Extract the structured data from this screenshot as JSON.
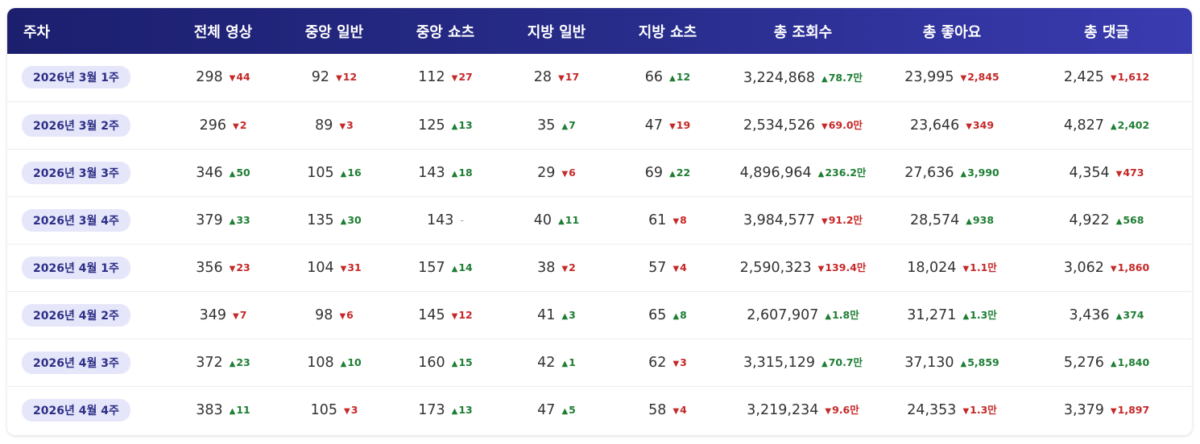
{
  "headers": [
    "주차",
    "전체 영상",
    "중앙 일반",
    "중앙 쇼츠",
    "지방 일반",
    "지방 쇼츠",
    "총 조회수",
    "총 좋아요",
    "총 댓글"
  ],
  "rows": [
    {
      "week": "2026년 3월 1주",
      "cells": [
        {
          "v": "298",
          "d": "44",
          "dir": "down"
        },
        {
          "v": "92",
          "d": "12",
          "dir": "down"
        },
        {
          "v": "112",
          "d": "27",
          "dir": "down"
        },
        {
          "v": "28",
          "d": "17",
          "dir": "down"
        },
        {
          "v": "66",
          "d": "12",
          "dir": "up"
        },
        {
          "v": "3,224,868",
          "d": "78.7만",
          "dir": "up"
        },
        {
          "v": "23,995",
          "d": "2,845",
          "dir": "down"
        },
        {
          "v": "2,425",
          "d": "1,612",
          "dir": "down"
        }
      ]
    },
    {
      "week": "2026년 3월 2주",
      "cells": [
        {
          "v": "296",
          "d": "2",
          "dir": "down"
        },
        {
          "v": "89",
          "d": "3",
          "dir": "down"
        },
        {
          "v": "125",
          "d": "13",
          "dir": "up"
        },
        {
          "v": "35",
          "d": "7",
          "dir": "up"
        },
        {
          "v": "47",
          "d": "19",
          "dir": "down"
        },
        {
          "v": "2,534,526",
          "d": "69.0만",
          "dir": "down"
        },
        {
          "v": "23,646",
          "d": "349",
          "dir": "down"
        },
        {
          "v": "4,827",
          "d": "2,402",
          "dir": "up"
        }
      ]
    },
    {
      "week": "2026년 3월 3주",
      "cells": [
        {
          "v": "346",
          "d": "50",
          "dir": "up"
        },
        {
          "v": "105",
          "d": "16",
          "dir": "up"
        },
        {
          "v": "143",
          "d": "18",
          "dir": "up"
        },
        {
          "v": "29",
          "d": "6",
          "dir": "down"
        },
        {
          "v": "69",
          "d": "22",
          "dir": "up"
        },
        {
          "v": "4,896,964",
          "d": "236.2만",
          "dir": "up"
        },
        {
          "v": "27,636",
          "d": "3,990",
          "dir": "up"
        },
        {
          "v": "4,354",
          "d": "473",
          "dir": "down"
        }
      ]
    },
    {
      "week": "2026년 3월 4주",
      "cells": [
        {
          "v": "379",
          "d": "33",
          "dir": "up"
        },
        {
          "v": "135",
          "d": "30",
          "dir": "up"
        },
        {
          "v": "143",
          "d": "-",
          "dir": "flat"
        },
        {
          "v": "40",
          "d": "11",
          "dir": "up"
        },
        {
          "v": "61",
          "d": "8",
          "dir": "down"
        },
        {
          "v": "3,984,577",
          "d": "91.2만",
          "dir": "down"
        },
        {
          "v": "28,574",
          "d": "938",
          "dir": "up"
        },
        {
          "v": "4,922",
          "d": "568",
          "dir": "up"
        }
      ]
    },
    {
      "week": "2026년 4월 1주",
      "cells": [
        {
          "v": "356",
          "d": "23",
          "dir": "down"
        },
        {
          "v": "104",
          "d": "31",
          "dir": "down"
        },
        {
          "v": "157",
          "d": "14",
          "dir": "up"
        },
        {
          "v": "38",
          "d": "2",
          "dir": "down"
        },
        {
          "v": "57",
          "d": "4",
          "dir": "down"
        },
        {
          "v": "2,590,323",
          "d": "139.4만",
          "dir": "down"
        },
        {
          "v": "18,024",
          "d": "1.1만",
          "dir": "down"
        },
        {
          "v": "3,062",
          "d": "1,860",
          "dir": "down"
        }
      ]
    },
    {
      "week": "2026년 4월 2주",
      "cells": [
        {
          "v": "349",
          "d": "7",
          "dir": "down"
        },
        {
          "v": "98",
          "d": "6",
          "dir": "down"
        },
        {
          "v": "145",
          "d": "12",
          "dir": "down"
        },
        {
          "v": "41",
          "d": "3",
          "dir": "up"
        },
        {
          "v": "65",
          "d": "8",
          "dir": "up"
        },
        {
          "v": "2,607,907",
          "d": "1.8만",
          "dir": "up"
        },
        {
          "v": "31,271",
          "d": "1.3만",
          "dir": "up"
        },
        {
          "v": "3,436",
          "d": "374",
          "dir": "up"
        }
      ]
    },
    {
      "week": "2026년 4월 3주",
      "cells": [
        {
          "v": "372",
          "d": "23",
          "dir": "up"
        },
        {
          "v": "108",
          "d": "10",
          "dir": "up"
        },
        {
          "v": "160",
          "d": "15",
          "dir": "up"
        },
        {
          "v": "42",
          "d": "1",
          "dir": "up"
        },
        {
          "v": "62",
          "d": "3",
          "dir": "down"
        },
        {
          "v": "3,315,129",
          "d": "70.7만",
          "dir": "up"
        },
        {
          "v": "37,130",
          "d": "5,859",
          "dir": "up"
        },
        {
          "v": "5,276",
          "d": "1,840",
          "dir": "up"
        }
      ]
    },
    {
      "week": "2026년 4월 4주",
      "cells": [
        {
          "v": "383",
          "d": "11",
          "dir": "up"
        },
        {
          "v": "105",
          "d": "3",
          "dir": "down"
        },
        {
          "v": "173",
          "d": "13",
          "dir": "up"
        },
        {
          "v": "47",
          "d": "5",
          "dir": "up"
        },
        {
          "v": "58",
          "d": "4",
          "dir": "down"
        },
        {
          "v": "3,219,234",
          "d": "9.6만",
          "dir": "down"
        },
        {
          "v": "24,353",
          "d": "1.3만",
          "dir": "down"
        },
        {
          "v": "3,379",
          "d": "1,897",
          "dir": "down"
        }
      ]
    }
  ],
  "colors": {
    "header_start": "#1c1f6e",
    "header_end": "#3a3bb0",
    "up": "#1e7e34",
    "down": "#c62828",
    "badge_bg": "#e6e6fb"
  },
  "icons": {
    "up": "triangle-up-icon",
    "down": "triangle-down-icon"
  }
}
